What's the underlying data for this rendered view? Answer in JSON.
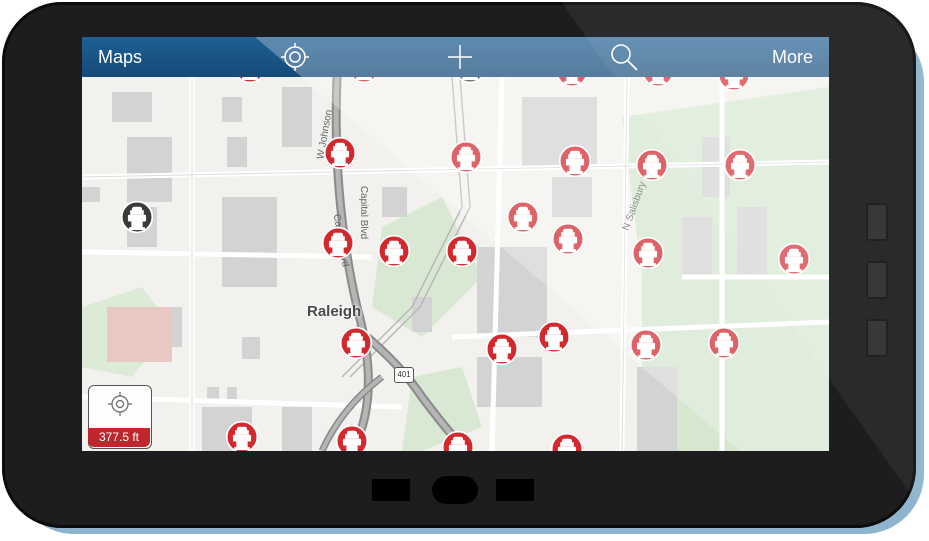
{
  "app": {
    "nav_left_label": "Maps",
    "nav_right_label": "More",
    "nav_icons": [
      "locate-icon",
      "plus-icon",
      "search-icon"
    ]
  },
  "map": {
    "city_label": "Raleigh",
    "street_labels": {
      "w_johnson": "W Johnson",
      "capital_blvd_a": "Capital Blvd",
      "capital_blvd_b": "Capital Blvd",
      "n_salisbury": "N Salisbury St"
    },
    "route_shield": "401",
    "scale_label": "377.5 ft",
    "colors": {
      "nav_bar": "#1a5687",
      "hydrant_active": "#d2282e",
      "hydrant_inactive": "#3a3a3a",
      "park_green": "#cfe3c6",
      "road_gray": "#8a8a8a"
    }
  }
}
